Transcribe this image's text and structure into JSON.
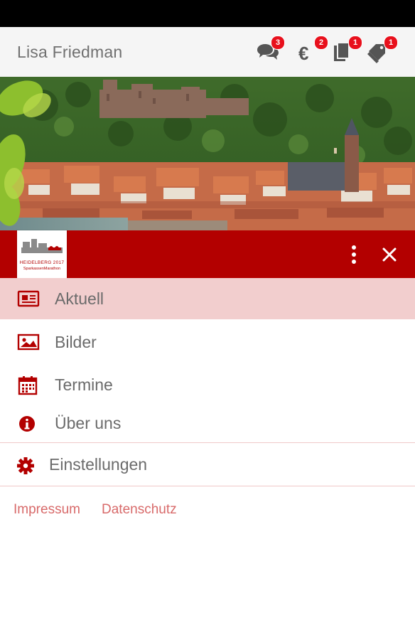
{
  "header": {
    "user_name": "Lisa Friedman",
    "icons": [
      {
        "name": "chat-bubbles-icon",
        "badge": "3"
      },
      {
        "name": "euro-icon",
        "badge": "2"
      },
      {
        "name": "documents-icon",
        "badge": "1"
      },
      {
        "name": "tags-icon",
        "badge": "1"
      }
    ]
  },
  "hero": {
    "image": "Heidelberg old town and castle panorama"
  },
  "logo": {
    "line1": "HEIDELBERG 2017",
    "line2": "SparkassenMarathon"
  },
  "toolbar": {
    "more_icon": "more-vertical-icon",
    "close_icon": "close-icon"
  },
  "menu": {
    "items": [
      {
        "label": "Aktuell",
        "icon": "newspaper-icon",
        "active": true
      },
      {
        "label": "Bilder",
        "icon": "image-icon",
        "active": false
      },
      {
        "label": "Termine",
        "icon": "calendar-icon",
        "active": false
      },
      {
        "label": "Über uns",
        "icon": "info-icon",
        "active": false
      }
    ],
    "settings": {
      "label": "Einstellungen",
      "icon": "gear-icon"
    }
  },
  "footer": {
    "impressum": "Impressum",
    "datenschutz": "Datenschutz"
  },
  "colors": {
    "brand_red": "#b30000",
    "active_bg": "#f2cece",
    "badge_red": "#e8101c",
    "link": "#d86a6a"
  }
}
